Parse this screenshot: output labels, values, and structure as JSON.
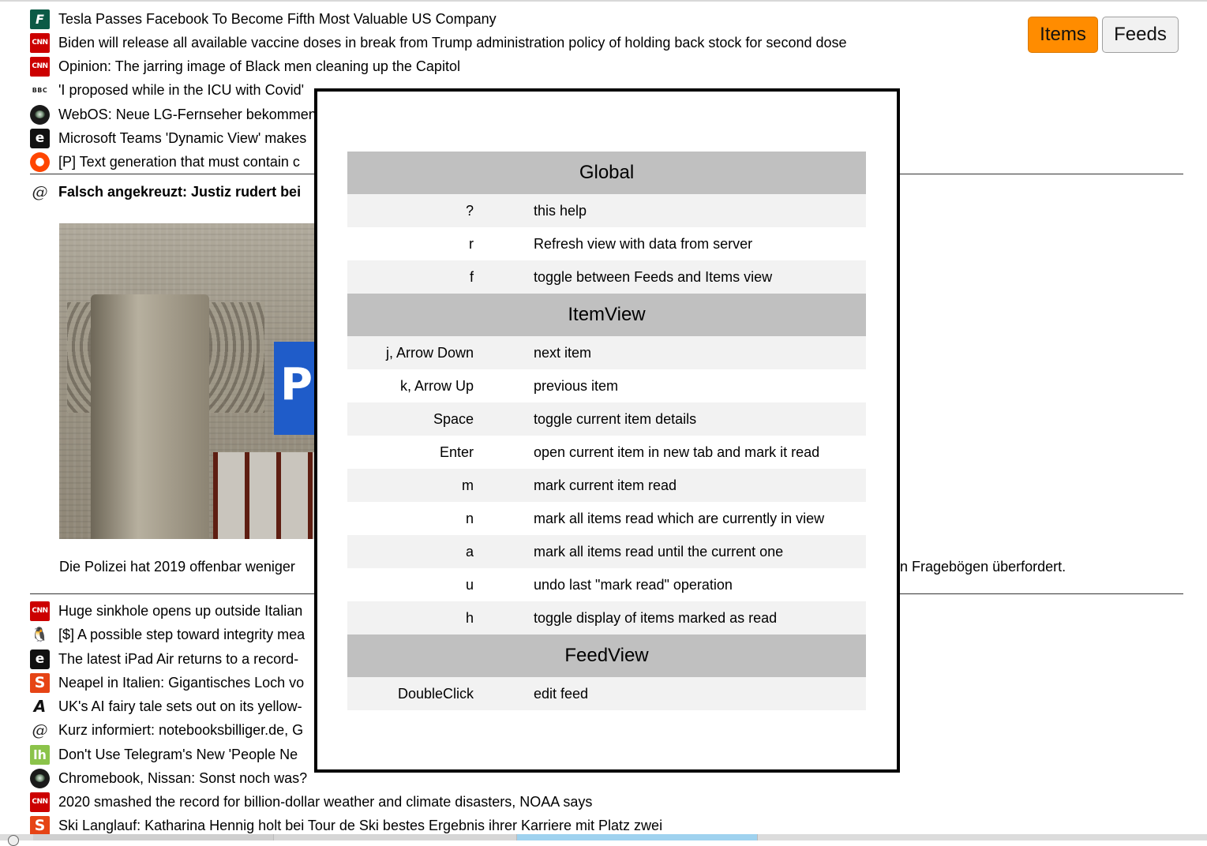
{
  "view_toggle": {
    "items_label": "Items",
    "feeds_label": "Feeds",
    "active": "Items",
    "active_color": "#ff8c00"
  },
  "items_above": [
    {
      "icon": "forbes-icon",
      "title": "Tesla Passes Facebook To Become Fifth Most Valuable US Company"
    },
    {
      "icon": "cnn-icon",
      "title": "Biden will release all available vaccine doses in break from Trump administration policy of holding back stock for second dose"
    },
    {
      "icon": "cnn-icon",
      "title": "Opinion: The jarring image of Black men cleaning up the Capitol"
    },
    {
      "icon": "bbc-icon",
      "title": "'I proposed while in the ICU with Covid'"
    },
    {
      "icon": "heise-icon",
      "title": "WebOS: Neue LG-Fernseher bekommen"
    },
    {
      "icon": "engadget-icon",
      "title": "Microsoft Teams 'Dynamic View' makes"
    },
    {
      "icon": "reddit-icon",
      "title": "[P] Text generation that must contain c"
    }
  ],
  "expanded_item": {
    "icon": "golem-icon",
    "title": "Falsch angekreuzt: Justiz rudert bei",
    "summary_left": "Die Polizei hat 2019 offenbar weniger",
    "summary_right": "n Fragebögen überfordert."
  },
  "items_below": [
    {
      "icon": "cnn-icon",
      "title": "Huge sinkhole opens up outside Italian"
    },
    {
      "icon": "linux-icon",
      "title": "[$] A possible step toward integrity mea"
    },
    {
      "icon": "engadget-icon",
      "title": "The latest iPad Air returns to a record-"
    },
    {
      "icon": "spiegel-icon",
      "title": "Neapel in Italien: Gigantisches Loch vo"
    },
    {
      "icon": "ars-icon",
      "title": "UK's AI fairy tale sets out on its yellow-"
    },
    {
      "icon": "golem-icon",
      "title": "Kurz informiert: notebooksbilliger.de, G"
    },
    {
      "icon": "lifehacker-icon",
      "title": "Don't Use Telegram's New 'People Ne"
    },
    {
      "icon": "heise-icon",
      "title": "Chromebook, Nissan: Sonst noch was?"
    },
    {
      "icon": "cnn-icon",
      "title": "2020 smashed the record for billion-dollar weather and climate disasters, NOAA says"
    },
    {
      "icon": "spiegel-icon",
      "title": "Ski Langlauf: Katharina Hennig holt bei Tour de Ski bestes Ergebnis ihrer Karriere mit Platz zwei"
    }
  ],
  "help": {
    "sections": [
      {
        "title": "Global",
        "rows": [
          {
            "key": "?",
            "desc": "this help"
          },
          {
            "key": "r",
            "desc": "Refresh view with data from server"
          },
          {
            "key": "f",
            "desc": "toggle between Feeds and Items view"
          }
        ]
      },
      {
        "title": "ItemView",
        "rows": [
          {
            "key": "j, Arrow Down",
            "desc": "next item"
          },
          {
            "key": "k, Arrow Up",
            "desc": "previous item"
          },
          {
            "key": "Space",
            "desc": "toggle current item details"
          },
          {
            "key": "Enter",
            "desc": "open current item in new tab and mark it read"
          },
          {
            "key": "m",
            "desc": "mark current item read"
          },
          {
            "key": "n",
            "desc": "mark all items read which are currently in view"
          },
          {
            "key": "a",
            "desc": "mark all items read until the current one"
          },
          {
            "key": "u",
            "desc": "undo last \"mark read\" operation"
          },
          {
            "key": "h",
            "desc": "toggle display of items marked as read"
          }
        ]
      },
      {
        "title": "FeedView",
        "rows": [
          {
            "key": "DoubleClick",
            "desc": "edit feed"
          }
        ]
      }
    ]
  }
}
